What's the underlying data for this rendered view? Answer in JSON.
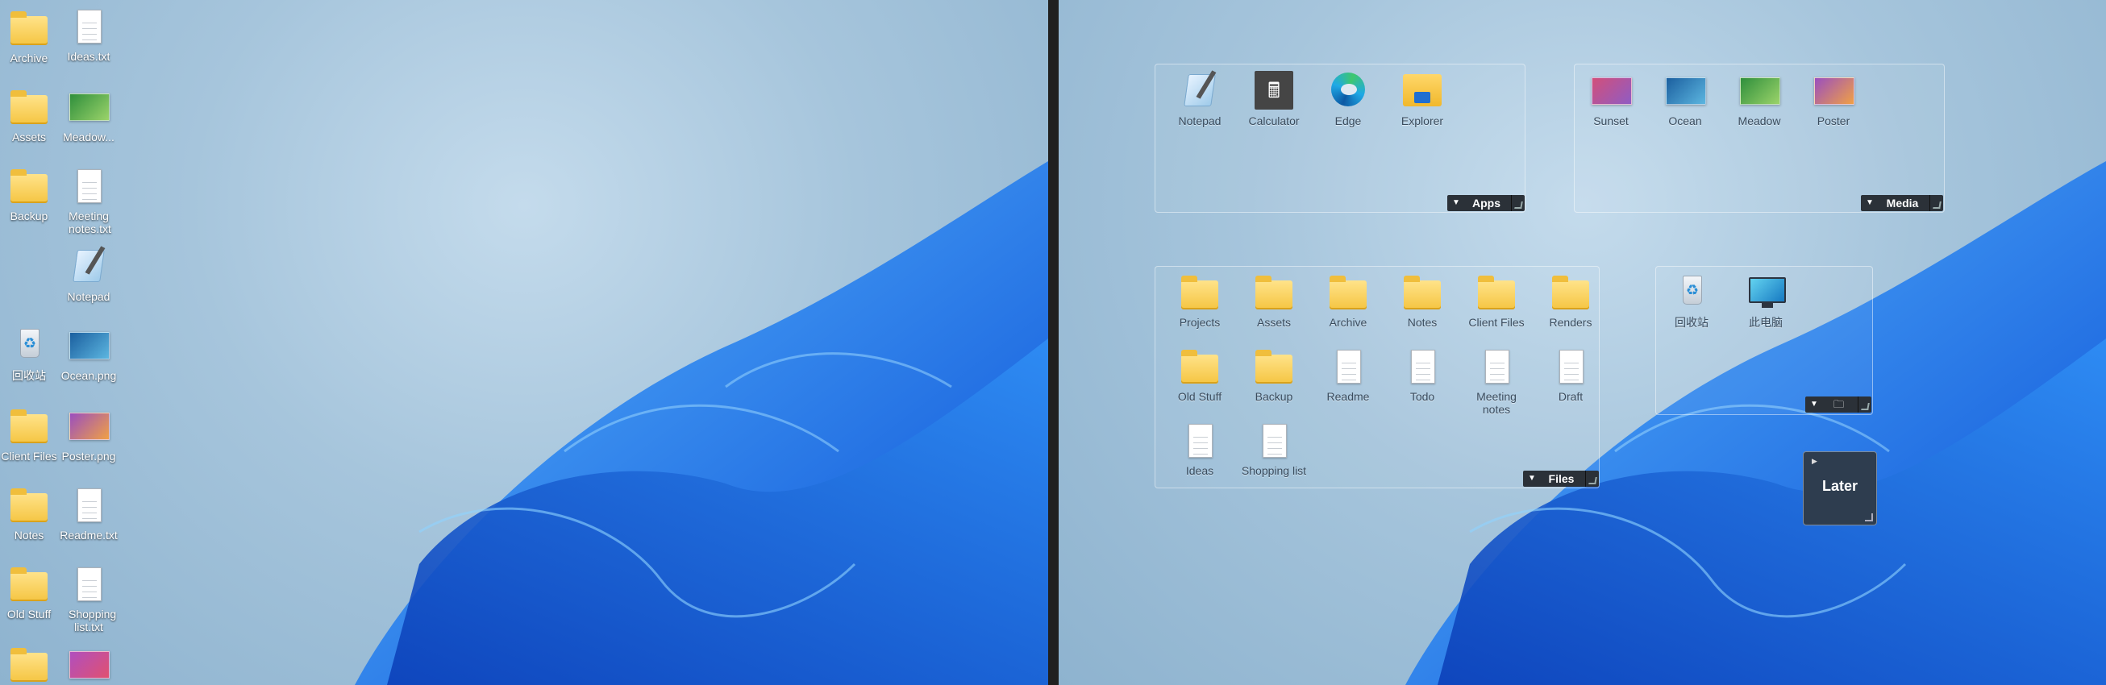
{
  "left_desktop": {
    "icons": [
      {
        "label": "Archive",
        "type": "folder"
      },
      {
        "label": "Ideas.txt",
        "type": "doc"
      },
      {
        "label": "Assets",
        "type": "folder"
      },
      {
        "label": "Meadow...",
        "type": "thumb-meadow"
      },
      {
        "label": "Backup",
        "type": "folder"
      },
      {
        "label": "Meeting notes.txt",
        "type": "doc"
      },
      {
        "label": "Notepad",
        "type": "notepad"
      },
      {
        "label": "回收站",
        "type": "bin"
      },
      {
        "label": "Ocean.png",
        "type": "thumb-ocean"
      },
      {
        "label": "Client Files",
        "type": "folder"
      },
      {
        "label": "Poster.png",
        "type": "thumb-poster"
      },
      {
        "label": "Notes",
        "type": "folder"
      },
      {
        "label": "Readme.txt",
        "type": "doc"
      },
      {
        "label": "Old Stuff",
        "type": "folder"
      },
      {
        "label": "Shopping list.txt",
        "type": "doc"
      },
      {
        "label": "",
        "type": "folder"
      },
      {
        "label": "",
        "type": "thumb-poster2"
      }
    ]
  },
  "fences": {
    "apps": {
      "title": "Apps",
      "items": [
        "Notepad",
        "Calculator",
        "Edge",
        "Explorer"
      ]
    },
    "media": {
      "title": "Media",
      "items": [
        "Sunset",
        "Ocean",
        "Meadow",
        "Poster"
      ]
    },
    "files": {
      "title": "Files",
      "items": [
        "Projects",
        "Assets",
        "Archive",
        "Notes",
        "Client Files",
        "Renders",
        "Old Stuff",
        "Backup",
        "Readme",
        "Todo",
        "Meeting notes",
        "Draft",
        "Ideas",
        "Shopping list"
      ]
    },
    "system": {
      "items": [
        "回收站",
        "此电脑"
      ]
    },
    "later": {
      "title": "Later"
    }
  },
  "icon_glyphs": {
    "recycle": "♻",
    "calculator": "🖩",
    "collapse_arrow": "▼",
    "expand_arrow": "▶",
    "folder_glyph": "🗀"
  },
  "colors": {
    "sunset": [
      "#d24f7a",
      "#8f5cc4"
    ],
    "ocean": [
      "#1b5f9f",
      "#5cb6e0"
    ],
    "meadow": [
      "#2f8f3c",
      "#9bd36a"
    ],
    "poster": [
      "#9a4fbf",
      "#f0a045"
    ],
    "fence_bar": "#2b3138",
    "later_bg": "#2e3d4f"
  }
}
